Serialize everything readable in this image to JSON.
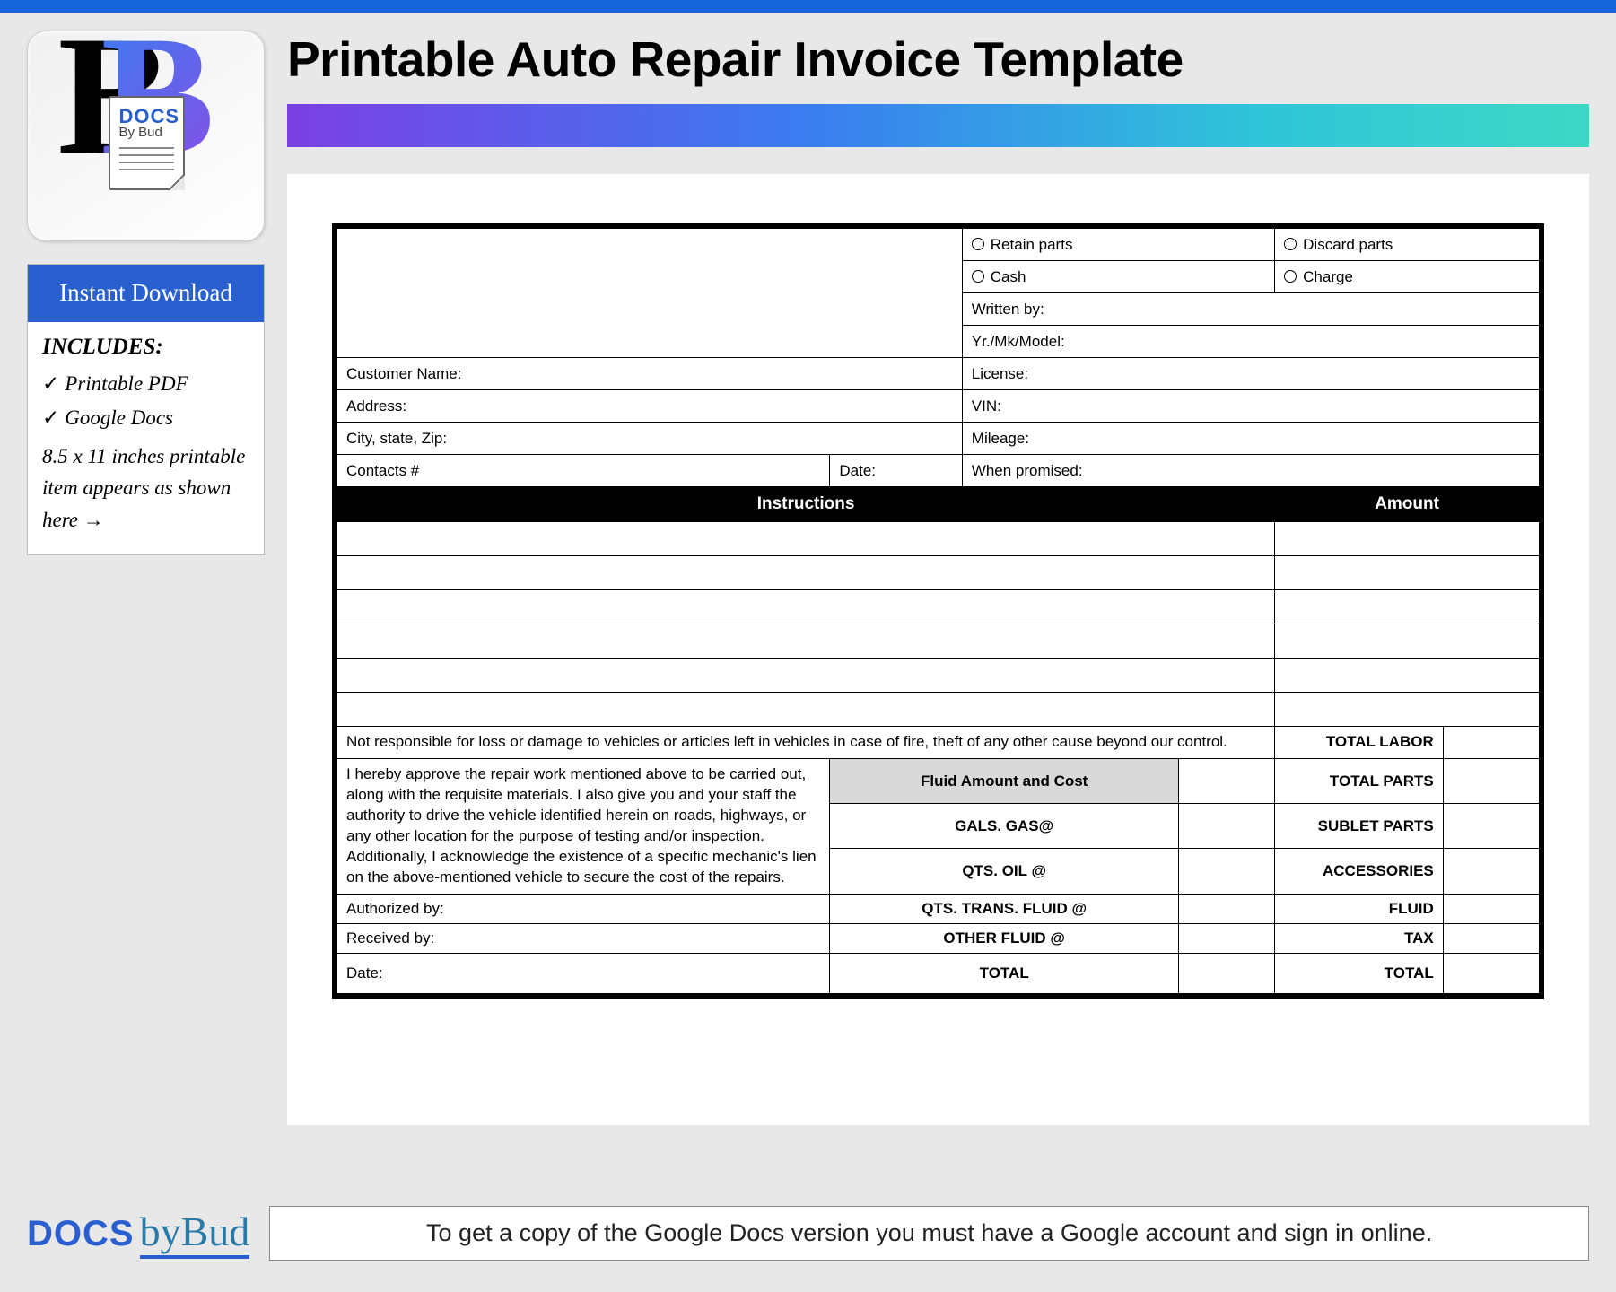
{
  "logo": {
    "docs": "DOCS",
    "byBud": "By Bud"
  },
  "sidebar": {
    "instantDownload": "Instant Download",
    "includesTitle": "INCLUDES:",
    "item1": "Printable PDF",
    "item2": "Google Docs",
    "sizeNote": "8.5 x 11 inches printable item appears as shown here →"
  },
  "title": "Printable Auto Repair Invoice Template",
  "invoice": {
    "retainParts": "Retain parts",
    "discardParts": "Discard parts",
    "cash": "Cash",
    "charge": "Charge",
    "writtenBy": "Written by:",
    "yrMkModel": "Yr./Mk/Model:",
    "customerName": "Customer Name:",
    "license": "License:",
    "address": "Address:",
    "vin": "VIN:",
    "cityStateZip": "City, state, Zip:",
    "mileage": "Mileage:",
    "contacts": "Contacts #",
    "date": "Date:",
    "whenPromised": "When promised:",
    "instructions": "Instructions",
    "amount": "Amount",
    "disclaimer": "Not responsible for loss or damage to vehicles or articles left in vehicles in case of fire, theft of any other cause beyond our control.",
    "totalLabor": "TOTAL LABOR",
    "approval": "I hereby approve the repair work mentioned above to be carried out, along with the requisite materials. I also give you and your staff the authority to drive the vehicle identified herein on roads, highways, or any other location for the purpose of testing and/or inspection. Additionally, I acknowledge the existence of a specific mechanic's lien on the above-mentioned vehicle to secure the cost of the repairs.",
    "fluidHeader": "Fluid Amount and Cost",
    "totalParts": "TOTAL PARTS",
    "galsGas": "GALS. GAS@",
    "subletParts": "SUBLET PARTS",
    "qtsOil": "QTS. OIL @",
    "accessories": "ACCESSORIES",
    "authorizedBy": "Authorized by:",
    "qtsTrans": "QTS. TRANS. FLUID @",
    "fluid": "FLUID",
    "receivedBy": "Received by:",
    "otherFluid": "OTHER FLUID @",
    "tax": "TAX",
    "dateBtm": "Date:",
    "totalFluid": "TOTAL",
    "total": "TOTAL"
  },
  "footer": {
    "docs": "DOCS",
    "byBud": "byBud",
    "note": "To get a copy of the Google Docs version you must have a Google account and sign in online."
  }
}
